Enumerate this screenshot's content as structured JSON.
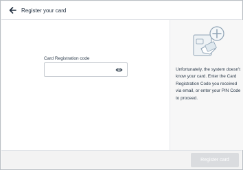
{
  "header": {
    "title": "Register your card",
    "back_icon": "arrow-left-icon"
  },
  "form": {
    "label": "Card Registration code",
    "value": "",
    "placeholder": "",
    "visibility_icon": "eye-icon"
  },
  "side": {
    "illustration_icon": "card-add-illustration",
    "message": "Unfortunately, the system doesn't know your card. Enter the Card Registration Code you received via email, or enter your PIN Code to proceed."
  },
  "footer": {
    "submit_label": "Register card",
    "submit_enabled": false
  },
  "colors": {
    "accent": "#1f2d3d",
    "disabled_button": "#dadcdf",
    "illustration": "#8fa3b5"
  }
}
